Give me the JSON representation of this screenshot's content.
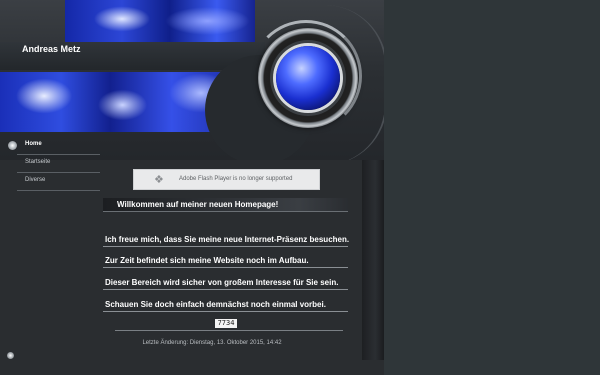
{
  "site": {
    "title": "Andreas Metz"
  },
  "nav": {
    "items": [
      {
        "label": "Home",
        "active": true
      },
      {
        "label": "Startseite",
        "active": false
      },
      {
        "label": "Diverse",
        "active": false
      }
    ]
  },
  "flash": {
    "message": "Adobe Flash Player is no longer supported",
    "icon": "plugin-icon"
  },
  "content": {
    "welcome": "Willkommen auf meiner neuen Homepage!",
    "paragraphs": [
      "Ich freue mich, dass Sie meine neue Internet-Präsenz besuchen.",
      "Zur Zeit befindet sich meine Website noch im Aufbau.",
      "Dieser Bereich wird sicher von großem Interesse für Sie sein.",
      "Schauen Sie doch einfach demnächst noch einmal vorbei."
    ],
    "counter": "7734"
  },
  "footer": {
    "last_modified": "Letzte Änderung: Dienstag, 13. Oktober 2015, 14:42"
  },
  "colors": {
    "accent_blue": "#2f4de0",
    "background": "#2a2d30"
  }
}
